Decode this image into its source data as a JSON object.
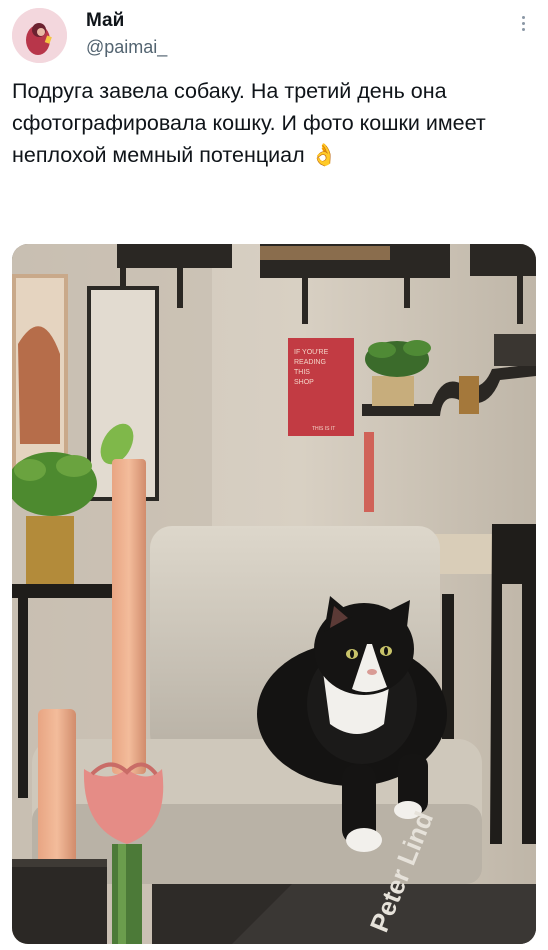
{
  "author": {
    "display_name": "Май",
    "handle": "@paimai_"
  },
  "tweet": {
    "text": "Подруга завела собаку. На третий день она сфотографировала кошку. И фото кошки имеет неплохой мемный потенциал",
    "emoji": "👌"
  },
  "poster": {
    "line1": "IF YOU'RE",
    "line2": "READING",
    "line3": "THIS",
    "line4": "SHOP",
    "footer": "THIS IS IT"
  },
  "book": {
    "title": "Peter Lind"
  }
}
